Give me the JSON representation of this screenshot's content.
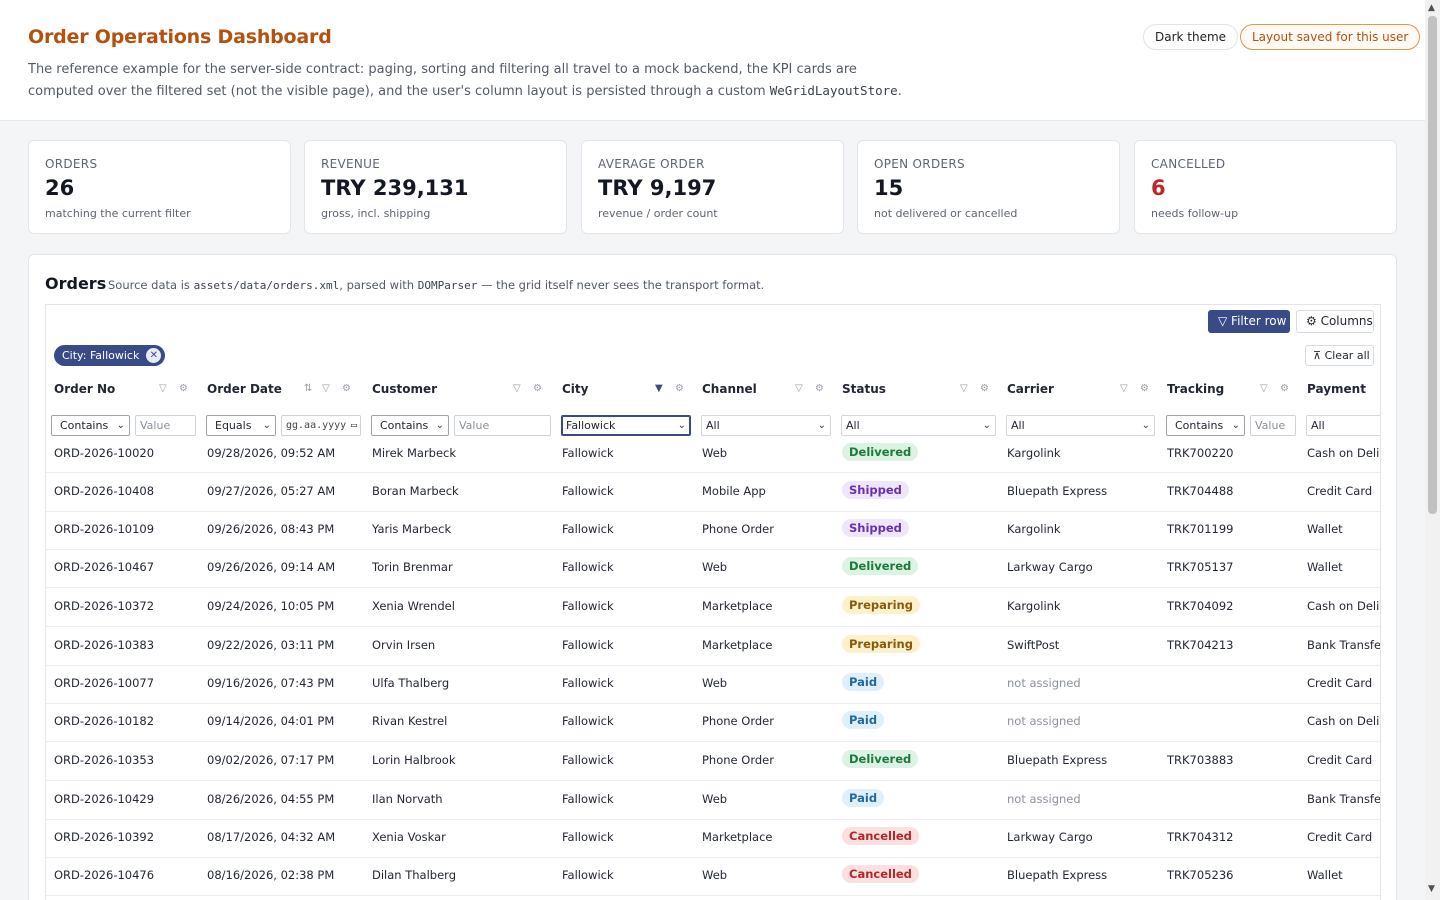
{
  "header": {
    "title": "Order Operations Dashboard",
    "desc_text": "The reference example for the server-side contract: paging, sorting and filtering all travel to a mock backend, the KPI cards are computed over the filtered set (not the visible page), and the user's column layout is persisted through a custom ",
    "desc_code": "WeGridLayoutStore",
    "desc_end": ".",
    "theme_button": "Dark theme",
    "saved_badge": "Layout saved for this user"
  },
  "kpis": [
    {
      "label": "ORDERS",
      "value": "26",
      "sub": "matching the current filter"
    },
    {
      "label": "REVENUE",
      "value": "TRY 239,131",
      "sub": "gross, incl. shipping"
    },
    {
      "label": "AVERAGE ORDER",
      "value": "TRY 9,197",
      "sub": "revenue / order count"
    },
    {
      "label": "OPEN ORDERS",
      "value": "15",
      "sub": "not delivered or cancelled"
    },
    {
      "label": "CANCELLED",
      "value": "6",
      "sub": "needs follow-up"
    }
  ],
  "orders": {
    "title": "Orders",
    "note_a": "Source data is ",
    "note_code1": "assets/data/orders.xml",
    "note_b": ", parsed with ",
    "note_code2": "DOMParser",
    "note_c": " — the grid itself never sees the transport format."
  },
  "toolbar": {
    "filter_row": "Filter row",
    "columns": "Columns",
    "chip": "City: Fallowick",
    "clear_all": "Clear all"
  },
  "columns": [
    "Order No",
    "Order Date",
    "Customer",
    "City",
    "Channel",
    "Status",
    "Carrier",
    "Tracking",
    "Payment"
  ],
  "filters": {
    "order_no_op": "Contains",
    "order_no_placeholder": "Value",
    "date_op": "Equals",
    "date_placeholder": "gg.aa.yyyy",
    "customer_op": "Contains",
    "customer_placeholder": "Value",
    "city_value": "Fallowick",
    "channel_value": "All",
    "status_value": "All",
    "carrier_value": "All",
    "tracking_op": "Contains",
    "tracking_placeholder": "Value",
    "payment_value": "All"
  },
  "rows": [
    {
      "order_no": "ORD-2026-10020",
      "date": "09/28/2026, 09:52 AM",
      "customer": "Mirek Marbeck",
      "city": "Fallowick",
      "channel": "Web",
      "status": "Delivered",
      "carrier": "Kargolink",
      "tracking": "TRK700220",
      "payment": "Cash on Delivery"
    },
    {
      "order_no": "ORD-2026-10408",
      "date": "09/27/2026, 05:27 AM",
      "customer": "Boran Marbeck",
      "city": "Fallowick",
      "channel": "Mobile App",
      "status": "Shipped",
      "carrier": "Bluepath Express",
      "tracking": "TRK704488",
      "payment": "Credit Card"
    },
    {
      "order_no": "ORD-2026-10109",
      "date": "09/26/2026, 08:43 PM",
      "customer": "Yaris Marbeck",
      "city": "Fallowick",
      "channel": "Phone Order",
      "status": "Shipped",
      "carrier": "Kargolink",
      "tracking": "TRK701199",
      "payment": "Wallet"
    },
    {
      "order_no": "ORD-2026-10467",
      "date": "09/26/2026, 09:14 AM",
      "customer": "Torin Brenmar",
      "city": "Fallowick",
      "channel": "Web",
      "status": "Delivered",
      "carrier": "Larkway Cargo",
      "tracking": "TRK705137",
      "payment": "Wallet"
    },
    {
      "order_no": "ORD-2026-10372",
      "date": "09/24/2026, 10:05 PM",
      "customer": "Xenia Wrendel",
      "city": "Fallowick",
      "channel": "Marketplace",
      "status": "Preparing",
      "carrier": "Kargolink",
      "tracking": "TRK704092",
      "payment": "Cash on Delivery"
    },
    {
      "order_no": "ORD-2026-10383",
      "date": "09/22/2026, 03:11 PM",
      "customer": "Orvin Irsen",
      "city": "Fallowick",
      "channel": "Marketplace",
      "status": "Preparing",
      "carrier": "SwiftPost",
      "tracking": "TRK704213",
      "payment": "Bank Transfer"
    },
    {
      "order_no": "ORD-2026-10077",
      "date": "09/16/2026, 07:43 PM",
      "customer": "Ulfa Thalberg",
      "city": "Fallowick",
      "channel": "Web",
      "status": "Paid",
      "carrier": "not assigned",
      "tracking": "",
      "payment": "Credit Card"
    },
    {
      "order_no": "ORD-2026-10182",
      "date": "09/14/2026, 04:01 PM",
      "customer": "Rivan Kestrel",
      "city": "Fallowick",
      "channel": "Phone Order",
      "status": "Paid",
      "carrier": "not assigned",
      "tracking": "",
      "payment": "Cash on Delivery"
    },
    {
      "order_no": "ORD-2026-10353",
      "date": "09/02/2026, 07:17 PM",
      "customer": "Lorin Halbrook",
      "city": "Fallowick",
      "channel": "Phone Order",
      "status": "Delivered",
      "carrier": "Bluepath Express",
      "tracking": "TRK703883",
      "payment": "Credit Card"
    },
    {
      "order_no": "ORD-2026-10429",
      "date": "08/26/2026, 04:55 PM",
      "customer": "Ilan Norvath",
      "city": "Fallowick",
      "channel": "Web",
      "status": "Paid",
      "carrier": "not assigned",
      "tracking": "",
      "payment": "Bank Transfer"
    },
    {
      "order_no": "ORD-2026-10392",
      "date": "08/17/2026, 04:32 AM",
      "customer": "Xenia Voskar",
      "city": "Fallowick",
      "channel": "Marketplace",
      "status": "Cancelled",
      "carrier": "Larkway Cargo",
      "tracking": "TRK704312",
      "payment": "Credit Card"
    },
    {
      "order_no": "ORD-2026-10476",
      "date": "08/16/2026, 02:38 PM",
      "customer": "Dilan Thalberg",
      "city": "Fallowick",
      "channel": "Web",
      "status": "Cancelled",
      "carrier": "Bluepath Express",
      "tracking": "TRK705236",
      "payment": "Wallet"
    }
  ],
  "colors": {
    "accent": "#3a4a86",
    "title": "#b5510f",
    "danger": "#c0252a"
  }
}
